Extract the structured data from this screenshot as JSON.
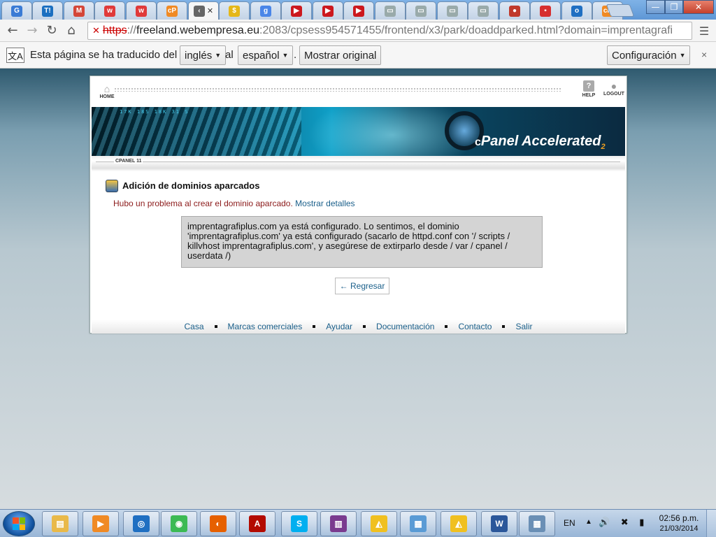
{
  "tabs": [
    {
      "icon": "google-reader-icon",
      "glyph": "G",
      "color": "#3a7bd5"
    },
    {
      "icon": "t-icon",
      "glyph": "T!",
      "color": "#1b6fc0"
    },
    {
      "icon": "gmail-icon",
      "glyph": "M",
      "color": "#d44638"
    },
    {
      "icon": "w-icon",
      "glyph": "w",
      "color": "#e03a3a"
    },
    {
      "icon": "w-icon",
      "glyph": "w",
      "color": "#e03a3a"
    },
    {
      "icon": "cpanel-icon",
      "glyph": "cP",
      "color": "#f08a24"
    },
    {
      "icon": "current-tab-icon",
      "glyph": "‹",
      "color": "#666",
      "active": true
    },
    {
      "icon": "coin-icon",
      "glyph": "$",
      "color": "#e5b719"
    },
    {
      "icon": "google-icon",
      "glyph": "g",
      "color": "#4a86e8"
    },
    {
      "icon": "youtube-icon",
      "glyph": "▶",
      "color": "#cc181e"
    },
    {
      "icon": "youtube-icon",
      "glyph": "▶",
      "color": "#cc181e"
    },
    {
      "icon": "youtube-icon",
      "glyph": "▶",
      "color": "#cc181e"
    },
    {
      "icon": "page-icon",
      "glyph": "▭",
      "color": "#9aa"
    },
    {
      "icon": "page-icon",
      "glyph": "▭",
      "color": "#9aa"
    },
    {
      "icon": "page-icon",
      "glyph": "▭",
      "color": "#9aa"
    },
    {
      "icon": "page-icon",
      "glyph": "▭",
      "color": "#9aa"
    },
    {
      "icon": "red-circle-icon",
      "glyph": "●",
      "color": "#c0392b"
    },
    {
      "icon": "red-square-icon",
      "glyph": "▪",
      "color": "#d62f2f"
    },
    {
      "icon": "outlook-icon",
      "glyph": "o",
      "color": "#1f6fc2"
    },
    {
      "icon": "cpanel-icon",
      "glyph": "cP",
      "color": "#f08a24"
    }
  ],
  "window": {
    "min": "—",
    "max": "❐",
    "close": "✕"
  },
  "toolbar": {
    "back": "←",
    "forward": "→",
    "reload": "↻",
    "home": "⌂",
    "url_scheme": "https",
    "url_host": "freeland.webempresa.eu",
    "url_path": ":2083/cpsess954571455/frontend/x3/park/doaddparked.html?domain=imprentagrafi",
    "menu": "☰"
  },
  "translate": {
    "text": "Esta página se ha traducido del",
    "from_lang": "inglés",
    "al": "al",
    "to_lang": "español",
    "dot": ".",
    "show_original": "Mostrar original",
    "settings": "Configuración",
    "close": "×"
  },
  "cpanel": {
    "home_label": "HOME",
    "help_label": "HELP",
    "logout_label": "LOGOUT",
    "banner_ticker": "17K   18S   18K   31   S",
    "logo_c": "c",
    "logo_panel": "Panel",
    "logo_accelerated": "Accelerated",
    "logo_2": "2",
    "version_label": "CPANEL 11",
    "section_title": "Adición de dominios aparcados",
    "error_text": "Hubo un problema al crear el dominio aparcado.",
    "error_link": "Mostrar detalles",
    "error_detail": "imprentagrafiplus.com ya está configurado. Lo sentimos, el dominio 'imprentagrafiplus.com' ya está configurado (sacarlo de httpd.conf con '/ scripts / killvhost imprentagrafiplus.com', y asegúrese de extirparlo desde / var / cpanel / userdata /)",
    "back_button": "← Regresar",
    "footer": [
      "Casa",
      "Marcas comerciales",
      "Ayudar",
      "Documentación",
      "Contacto",
      "Salir"
    ]
  },
  "taskbar": {
    "apps": [
      {
        "icon": "file-explorer-icon",
        "glyph": "▤",
        "color": "#e9b949"
      },
      {
        "icon": "media-player-icon",
        "glyph": "▶",
        "color": "#f08a24"
      },
      {
        "icon": "network-icon",
        "glyph": "◎",
        "color": "#1f6fc2"
      },
      {
        "icon": "chrome-icon",
        "glyph": "◉",
        "color": "#3cba54"
      },
      {
        "icon": "firefox-icon",
        "glyph": "◐",
        "color": "#e66000"
      },
      {
        "icon": "acrobat-icon",
        "glyph": "A",
        "color": "#b30b00"
      },
      {
        "icon": "skype-icon",
        "glyph": "S",
        "color": "#00aff0"
      },
      {
        "icon": "winrar-icon",
        "glyph": "▥",
        "color": "#7a3b8f"
      },
      {
        "icon": "paint-icon",
        "glyph": "◭",
        "color": "#f0c020"
      },
      {
        "icon": "notepad-icon",
        "glyph": "▦",
        "color": "#5a9bd5"
      },
      {
        "icon": "paint-icon",
        "glyph": "◭",
        "color": "#f0c020"
      },
      {
        "icon": "word-icon",
        "glyph": "W",
        "color": "#2b579a"
      },
      {
        "icon": "calculator-icon",
        "glyph": "▦",
        "color": "#6a8fb5"
      }
    ],
    "lang": "EN",
    "time": "02:56 p.m.",
    "date": "21/03/2014"
  }
}
